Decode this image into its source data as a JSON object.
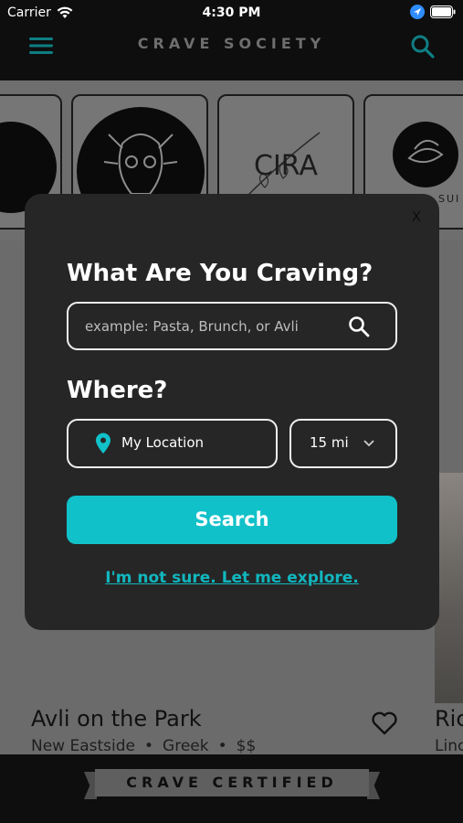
{
  "status_bar": {
    "carrier": "Carrier",
    "time": "4:30 PM"
  },
  "nav": {
    "title": "CRAVE SOCIETY",
    "menu_icon": "hamburger-icon",
    "search_icon": "search-icon",
    "accent_color": "#11c1c9"
  },
  "carousel": {
    "cards": [
      {
        "logo_text": "CIRA"
      },
      {
        "logo_text": "SUI"
      }
    ]
  },
  "modal": {
    "close_label": "X",
    "craving_heading": "What Are You Craving?",
    "search_placeholder": "example: Pasta, Brunch, or Avli",
    "search_value": "",
    "where_heading": "Where?",
    "location_label": "My Location",
    "distance_value": "15 mi",
    "search_button": "Search",
    "explore_link": "I'm not sure. Let me explore."
  },
  "listings": [
    {
      "name": "Avli on the Park",
      "neighborhood": "New Eastside",
      "cuisine": "Greek",
      "price": "$$",
      "separator": "•"
    },
    {
      "name": "Ric",
      "neighborhood": "Linc"
    }
  ],
  "footer": {
    "banner_label": "CRAVE CERTIFIED"
  }
}
